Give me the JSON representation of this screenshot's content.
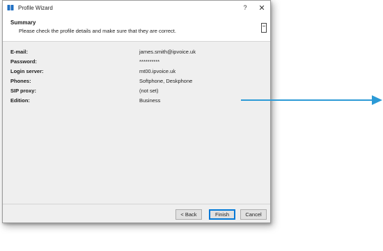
{
  "window": {
    "title": "Profile Wizard",
    "help_glyph": "?",
    "close_glyph": "✕"
  },
  "header": {
    "title": "Summary",
    "subtitle": "Please check the profile details and make sure that they are correct."
  },
  "details": [
    {
      "label": "E-mail:",
      "value": "james.smith@ipvoice.uk"
    },
    {
      "label": "Password:",
      "value": "**********"
    },
    {
      "label": "Login server:",
      "value": "mt00.ipvoice.uk"
    },
    {
      "label": "Phones:",
      "value": "Softphone, Deskphone"
    },
    {
      "label": "SIP proxy:",
      "value": "(not set)"
    },
    {
      "label": "Edition:",
      "value": "Business"
    }
  ],
  "buttons": {
    "back": "< Back",
    "finish": "Finish",
    "cancel": "Cancel"
  },
  "colors": {
    "arrow": "#2b9ad6",
    "app_icon": "#1f6fc2"
  },
  "icons": {
    "app": "phone-book-icon",
    "summary": "document-icon",
    "annotation": "arrow-right-icon"
  }
}
